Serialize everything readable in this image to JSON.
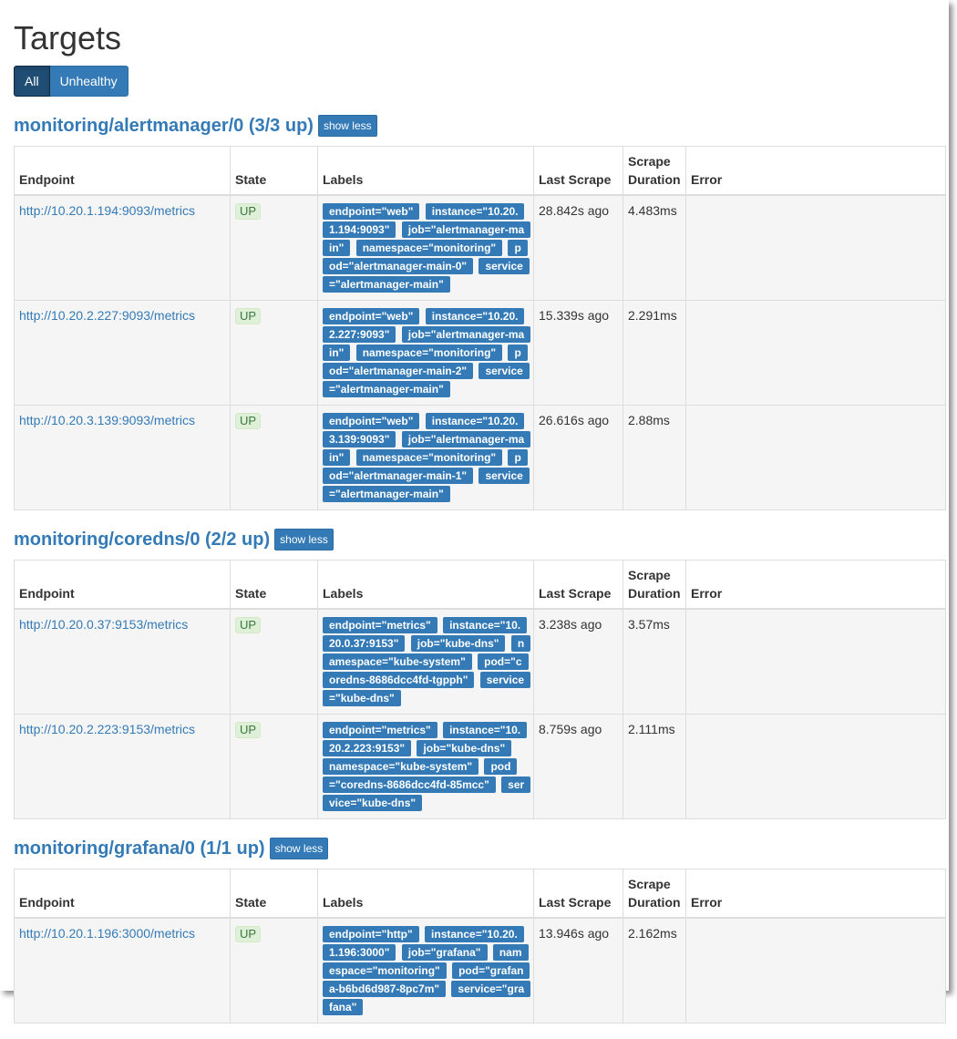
{
  "page": {
    "title": "Targets"
  },
  "filters": {
    "all_label": "All",
    "unhealthy_label": "Unhealthy"
  },
  "columns": {
    "endpoint": "Endpoint",
    "state": "State",
    "labels": "Labels",
    "last_scrape": "Last Scrape",
    "scrape_duration_line1": "Scrape",
    "scrape_duration_line2": "Duration",
    "error": "Error"
  },
  "show_less_label": "show less",
  "jobs": [
    {
      "title": "monitoring/alertmanager/0 (3/3 up)",
      "targets": [
        {
          "endpoint": "http://10.20.1.194:9093/metrics",
          "state": "UP",
          "labels": [
            "endpoint=\"web\"",
            "instance=\"10.20.1.194:9093\"",
            "job=\"alertmanager-main\"",
            "namespace=\"monitoring\"",
            "pod=\"alertmanager-main-0\"",
            "service=\"alertmanager-main\""
          ],
          "last_scrape": "28.842s ago",
          "duration": "4.483ms",
          "error": ""
        },
        {
          "endpoint": "http://10.20.2.227:9093/metrics",
          "state": "UP",
          "labels": [
            "endpoint=\"web\"",
            "instance=\"10.20.2.227:9093\"",
            "job=\"alertmanager-main\"",
            "namespace=\"monitoring\"",
            "pod=\"alertmanager-main-2\"",
            "service=\"alertmanager-main\""
          ],
          "last_scrape": "15.339s ago",
          "duration": "2.291ms",
          "error": ""
        },
        {
          "endpoint": "http://10.20.3.139:9093/metrics",
          "state": "UP",
          "labels": [
            "endpoint=\"web\"",
            "instance=\"10.20.3.139:9093\"",
            "job=\"alertmanager-main\"",
            "namespace=\"monitoring\"",
            "pod=\"alertmanager-main-1\"",
            "service=\"alertmanager-main\""
          ],
          "last_scrape": "26.616s ago",
          "duration": "2.88ms",
          "error": ""
        }
      ]
    },
    {
      "title": "monitoring/coredns/0 (2/2 up)",
      "targets": [
        {
          "endpoint": "http://10.20.0.37:9153/metrics",
          "state": "UP",
          "labels": [
            "endpoint=\"metrics\"",
            "instance=\"10.20.0.37:9153\"",
            "job=\"kube-dns\"",
            "namespace=\"kube-system\"",
            "pod=\"coredns-8686dcc4fd-tgpph\"",
            "service=\"kube-dns\""
          ],
          "last_scrape": "3.238s ago",
          "duration": "3.57ms",
          "error": ""
        },
        {
          "endpoint": "http://10.20.2.223:9153/metrics",
          "state": "UP",
          "labels": [
            "endpoint=\"metrics\"",
            "instance=\"10.20.2.223:9153\"",
            "job=\"kube-dns\"",
            "namespace=\"kube-system\"",
            "pod=\"coredns-8686dcc4fd-85mcc\"",
            "service=\"kube-dns\""
          ],
          "last_scrape": "8.759s ago",
          "duration": "2.111ms",
          "error": ""
        }
      ]
    },
    {
      "title": "monitoring/grafana/0 (1/1 up)",
      "targets": [
        {
          "endpoint": "http://10.20.1.196:3000/metrics",
          "state": "UP",
          "labels": [
            "endpoint=\"http\"",
            "instance=\"10.20.1.196:3000\"",
            "job=\"grafana\"",
            "namespace=\"monitoring\"",
            "pod=\"grafana-b6bd6d987-8pc7m\"",
            "service=\"grafana\""
          ],
          "last_scrape": "13.946s ago",
          "duration": "2.162ms",
          "error": ""
        }
      ]
    }
  ]
}
